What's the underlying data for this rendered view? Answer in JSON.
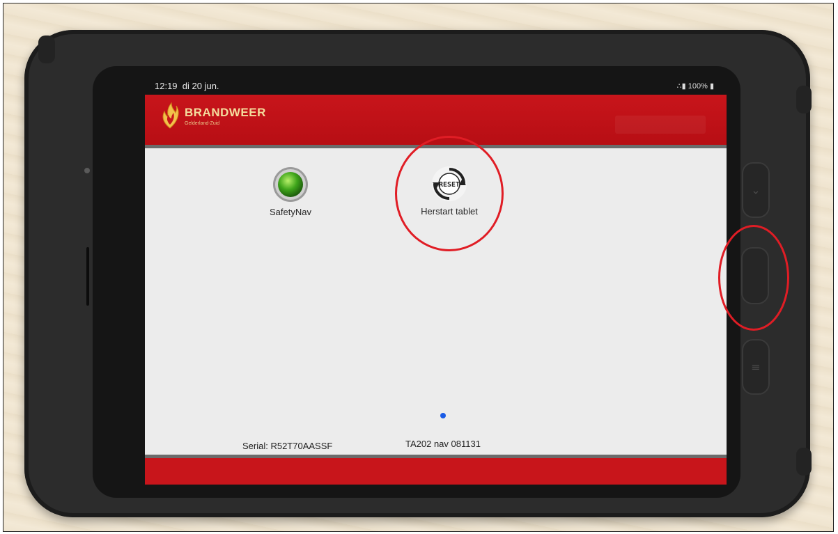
{
  "status_bar": {
    "time": "12:19",
    "date": "di 20 jun.",
    "battery": "100%"
  },
  "header": {
    "brand_name": "BRANDWEER",
    "brand_region": "Gelderland-Zuid"
  },
  "apps": [
    {
      "label": "SafetyNav",
      "icon": "green-status-light-icon"
    },
    {
      "label": "Herstart tablet",
      "icon": "reset-icon",
      "icon_text": "RESET"
    }
  ],
  "footer": {
    "serial": "Serial: R52T70AASSF",
    "device_id": "TA202 nav 081131"
  },
  "colors": {
    "header_red": "#c8151b",
    "annotation_red": "#e01d25",
    "page_indicator": "#1a5be6",
    "safetynav_green": "#3fa51b"
  }
}
